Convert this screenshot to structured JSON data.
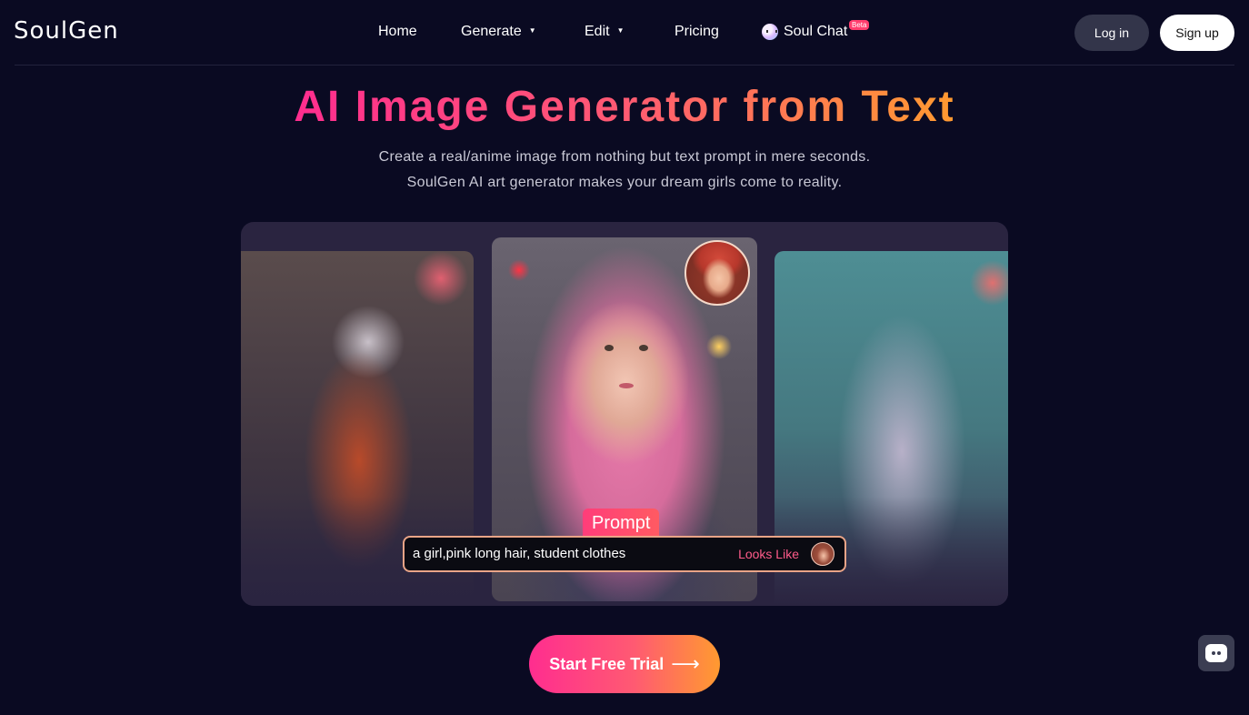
{
  "header": {
    "logo": "SoulGen",
    "nav": [
      {
        "label": "Home",
        "dropdown": false
      },
      {
        "label": "Generate",
        "dropdown": true
      },
      {
        "label": "Edit",
        "dropdown": true
      },
      {
        "label": "Pricing",
        "dropdown": false
      },
      {
        "label": "Soul Chat",
        "badge": "Beta",
        "icon": "soul-chat-icon"
      }
    ],
    "login_label": "Log in",
    "signup_label": "Sign up"
  },
  "hero": {
    "title": "AI Image Generator from Text",
    "subtitle_line1": "Create a real/anime image from nothing but text prompt in mere seconds.",
    "subtitle_line2": "SoulGen AI art generator makes your dream girls come to reality."
  },
  "showcase": {
    "prompt_tag": "Prompt",
    "prompt_text": "a girl,pink long hair, student clothes",
    "looks_like_label": "Looks Like"
  },
  "cta": {
    "label": "Start Free Trial",
    "arrow": "⟶"
  },
  "colors": {
    "background": "#0a0a22",
    "accent_start": "#ff2d8f",
    "accent_end": "#ff9a30",
    "showcase_bg": "#2a2440"
  }
}
